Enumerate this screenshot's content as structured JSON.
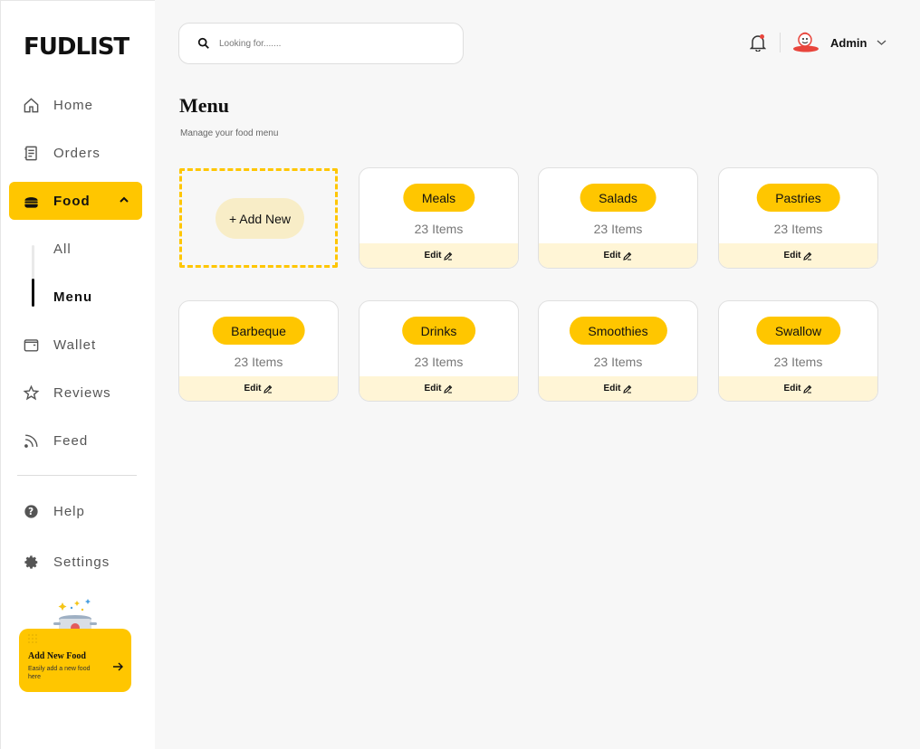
{
  "brand": {
    "logo_text": "FUDLIST"
  },
  "sidebar": {
    "items": [
      {
        "label": "Home"
      },
      {
        "label": "Orders"
      },
      {
        "label": "Food"
      },
      {
        "label": "Wallet"
      },
      {
        "label": "Reviews"
      },
      {
        "label": "Feed"
      },
      {
        "label": "Help"
      },
      {
        "label": "Settings"
      }
    ],
    "food_sub": [
      {
        "label": "All"
      },
      {
        "label": "Menu"
      }
    ],
    "promo": {
      "title": "Add New Food",
      "subtitle": "Easily add a new food here"
    }
  },
  "header": {
    "search_placeholder": "Looking for.......",
    "user_name": "Admin"
  },
  "page": {
    "title": "Menu",
    "subtitle": "Manage your food menu",
    "add_new_label": "+ Add New"
  },
  "categories": [
    {
      "name": "Meals",
      "count": "23 Items",
      "edit": "Edit"
    },
    {
      "name": "Salads",
      "count": "23 Items",
      "edit": "Edit"
    },
    {
      "name": "Pastries",
      "count": "23 Items",
      "edit": "Edit"
    },
    {
      "name": "Barbeque",
      "count": "23 Items",
      "edit": "Edit"
    },
    {
      "name": "Drinks",
      "count": "23 Items",
      "edit": "Edit"
    },
    {
      "name": "Smoothies",
      "count": "23 Items",
      "edit": "Edit"
    },
    {
      "name": "Swallow",
      "count": "23 Items",
      "edit": "Edit"
    }
  ],
  "colors": {
    "accent": "#ffc600",
    "accent_light": "#fff5d6",
    "background": "#f7f7f7"
  }
}
